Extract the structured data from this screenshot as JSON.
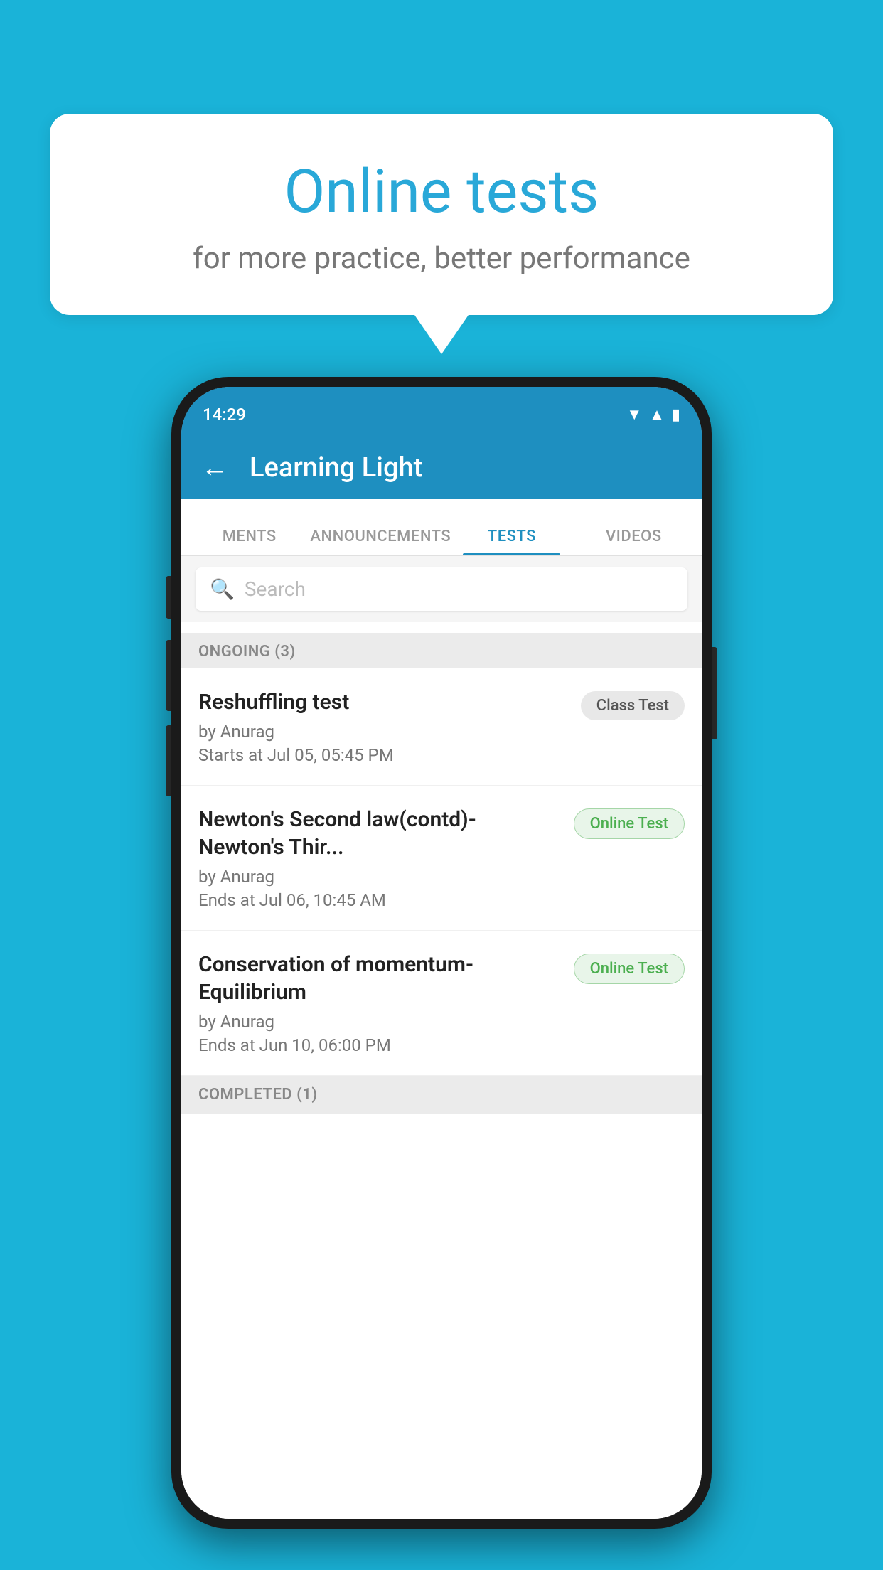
{
  "background": {
    "color": "#1ab3d8"
  },
  "speech_bubble": {
    "title": "Online tests",
    "subtitle": "for more practice, better performance"
  },
  "status_bar": {
    "time": "14:29",
    "icons": [
      "wifi",
      "signal",
      "battery"
    ]
  },
  "app_bar": {
    "back_label": "←",
    "title": "Learning Light"
  },
  "tabs": [
    {
      "label": "MENTS",
      "active": false
    },
    {
      "label": "ANNOUNCEMENTS",
      "active": false
    },
    {
      "label": "TESTS",
      "active": true
    },
    {
      "label": "VIDEOS",
      "active": false
    }
  ],
  "search": {
    "placeholder": "Search",
    "icon": "🔍"
  },
  "ongoing_section": {
    "header": "ONGOING (3)"
  },
  "tests": [
    {
      "name": "Reshuffling test",
      "author": "by Anurag",
      "date": "Starts at  Jul 05, 05:45 PM",
      "badge": "Class Test",
      "badge_type": "class"
    },
    {
      "name": "Newton's Second law(contd)-Newton's Thir...",
      "author": "by Anurag",
      "date": "Ends at  Jul 06, 10:45 AM",
      "badge": "Online Test",
      "badge_type": "online"
    },
    {
      "name": "Conservation of momentum-Equilibrium",
      "author": "by Anurag",
      "date": "Ends at  Jun 10, 06:00 PM",
      "badge": "Online Test",
      "badge_type": "online"
    }
  ],
  "completed_section": {
    "header": "COMPLETED (1)"
  }
}
